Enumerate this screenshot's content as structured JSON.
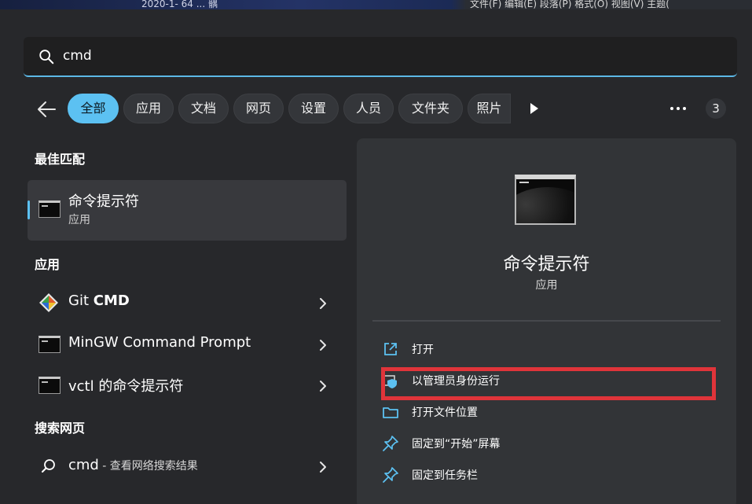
{
  "background": {
    "date_fragment": "2020-1- 64 ... 髃",
    "menu_fragment": "文件(F)  编辑(E)  段落(P)  格式(O)  视图(V)  主题("
  },
  "search": {
    "value": "cmd",
    "icon": "search-icon",
    "accent_color": "#5cb8e6"
  },
  "filters": {
    "items": [
      {
        "label": "全部",
        "active": true
      },
      {
        "label": "应用",
        "active": false
      },
      {
        "label": "文档",
        "active": false
      },
      {
        "label": "网页",
        "active": false
      },
      {
        "label": "设置",
        "active": false
      },
      {
        "label": "人员",
        "active": false
      },
      {
        "label": "文件夹",
        "active": false
      },
      {
        "label": "照片",
        "active": false
      }
    ],
    "count": "3"
  },
  "best_match": {
    "heading": "最佳匹配",
    "title": "命令提示符",
    "subtitle": "应用"
  },
  "apps": {
    "heading": "应用",
    "items": [
      {
        "prefix": "Git ",
        "bold": "CMD",
        "icon": "git-icon"
      },
      {
        "prefix": "MinGW Command Prompt",
        "bold": "",
        "icon": "terminal-icon"
      },
      {
        "prefix": "vctl 的命令提示符",
        "bold": "",
        "icon": "terminal-icon"
      }
    ]
  },
  "web": {
    "heading": "搜索网页",
    "query": "cmd",
    "suffix": " - 查看网络搜索结果"
  },
  "detail": {
    "title": "命令提示符",
    "subtitle": "应用",
    "actions": [
      {
        "label": "打开",
        "icon": "open-external-icon"
      },
      {
        "label": "以管理员身份运行",
        "icon": "shield-admin-icon"
      },
      {
        "label": "打开文件位置",
        "icon": "folder-icon"
      },
      {
        "label": "固定到“开始”屏幕",
        "icon": "pin-icon"
      },
      {
        "label": "固定到任务栏",
        "icon": "pin-icon"
      }
    ]
  },
  "colors": {
    "chip_active": "#5cc1f2",
    "highlight_border": "#e0343a"
  }
}
